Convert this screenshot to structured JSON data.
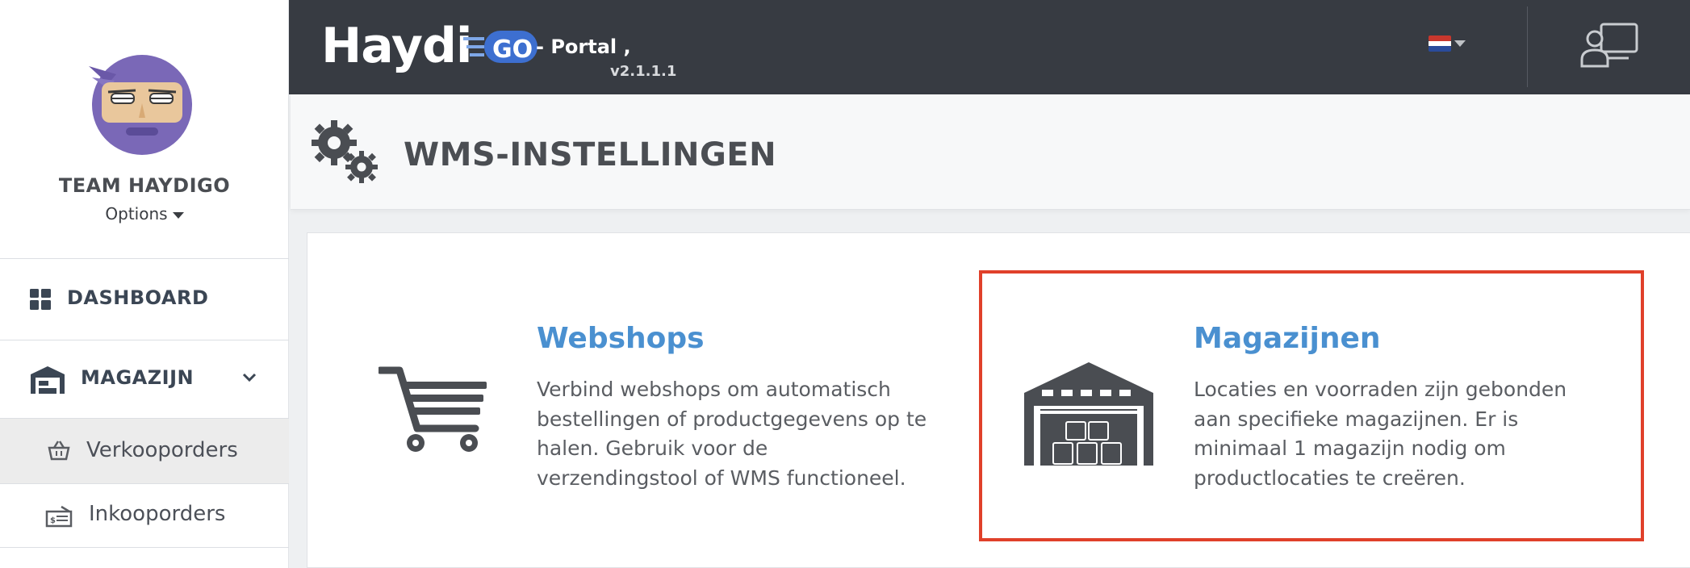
{
  "app": {
    "brand": "Haydi",
    "brand_badge": "GO",
    "portal_label": "- Portal ,",
    "version": "v2.1.1.1"
  },
  "user": {
    "name": "TEAM HAYDIGO",
    "options_label": "Options"
  },
  "sidebar": {
    "items": [
      {
        "label": "DASHBOARD",
        "icon": "dashboard-grid-icon"
      },
      {
        "label": "MAGAZIJN",
        "icon": "warehouse-icon",
        "expanded": true
      },
      {
        "label": "Verkooporders",
        "icon": "basket-icon",
        "active": true
      },
      {
        "label": "Inkooporders",
        "icon": "invoice-icon"
      }
    ]
  },
  "header": {
    "title": "WMS-INSTELLINGEN",
    "icon": "gears-icon",
    "language_icon": "flag-nl-icon",
    "profile_icon": "user-desk-icon"
  },
  "tiles": [
    {
      "title": "Webshops",
      "icon": "shopping-cart-icon",
      "lines": [
        "Verbind webshops om automatisch",
        "bestellingen of productgegevens op te",
        "halen. Gebruik voor de",
        "verzendingstool of WMS functioneel."
      ]
    },
    {
      "title": "Magazijnen",
      "icon": "warehouse-boxes-icon",
      "lines": [
        "Locaties en voorraden zijn gebonden",
        "aan specifieke magazijnen. Er is",
        "minimaal 1 magazijn nodig om",
        "productlocaties te creëren."
      ]
    }
  ],
  "colors": {
    "topbar": "#373b42",
    "link": "#4a90d0",
    "highlight": "#e0402a",
    "sidebar_active": "#ececec"
  }
}
